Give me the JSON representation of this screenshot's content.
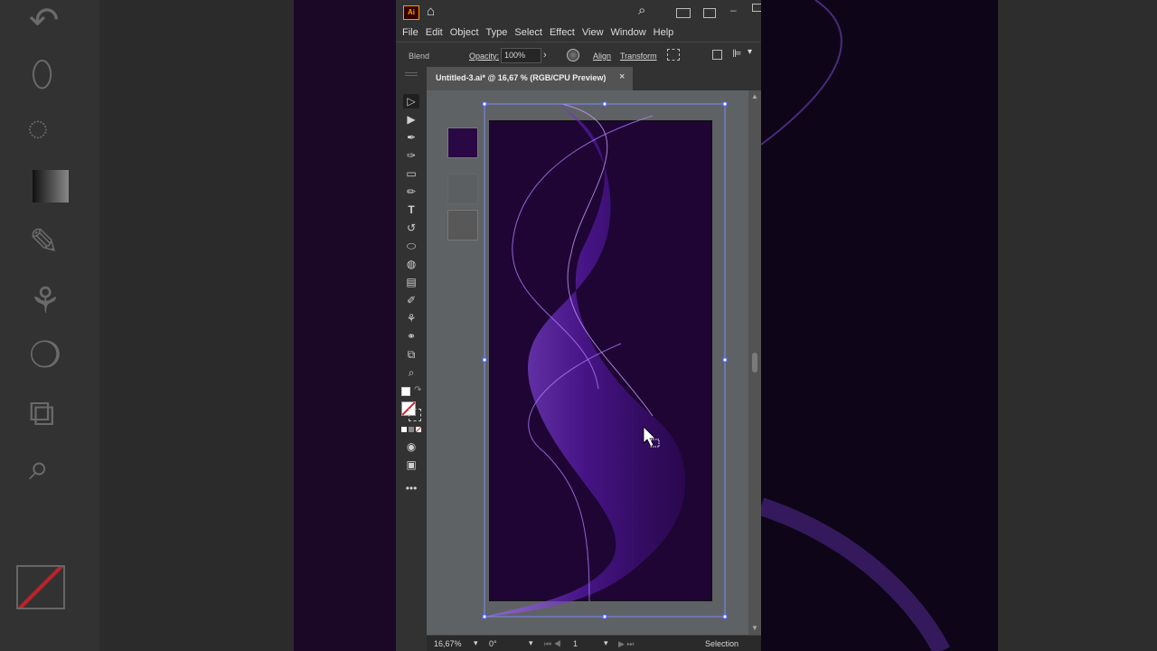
{
  "app": {
    "logo": "Ai"
  },
  "menu": [
    "File",
    "Edit",
    "Object",
    "Type",
    "Select",
    "Effect",
    "View",
    "Window",
    "Help"
  ],
  "control_bar": {
    "object_type": "Blend",
    "opacity_label": "Opacity:",
    "opacity_value": "100%",
    "align_label": "Align",
    "transform_label": "Transform"
  },
  "document_tab": {
    "title": "Untitled-3.ai* @ 16,67 % (RGB/CPU Preview)",
    "close": "×"
  },
  "tools": [
    "selection-tool",
    "direct-selection-tool",
    "pen-tool",
    "curvature-tool",
    "rectangle-tool",
    "pencil-tool",
    "type-tool",
    "rotate-tool",
    "eraser-tool",
    "shape-builder-tool",
    "gradient-tool",
    "eyedropper-tool",
    "puppet-warp-tool",
    "blend-tool",
    "artboard-tool",
    "zoom-tool"
  ],
  "status_bar": {
    "zoom": "16,67%",
    "rotation": "0°",
    "artboard_number": "1",
    "current_tool": "Selection"
  },
  "colors": {
    "artboard_bg": "#1e0533",
    "swatch_fill": "#2a0845",
    "wave_purple": "#7a2ee0",
    "wave_light": "#a66cff"
  }
}
